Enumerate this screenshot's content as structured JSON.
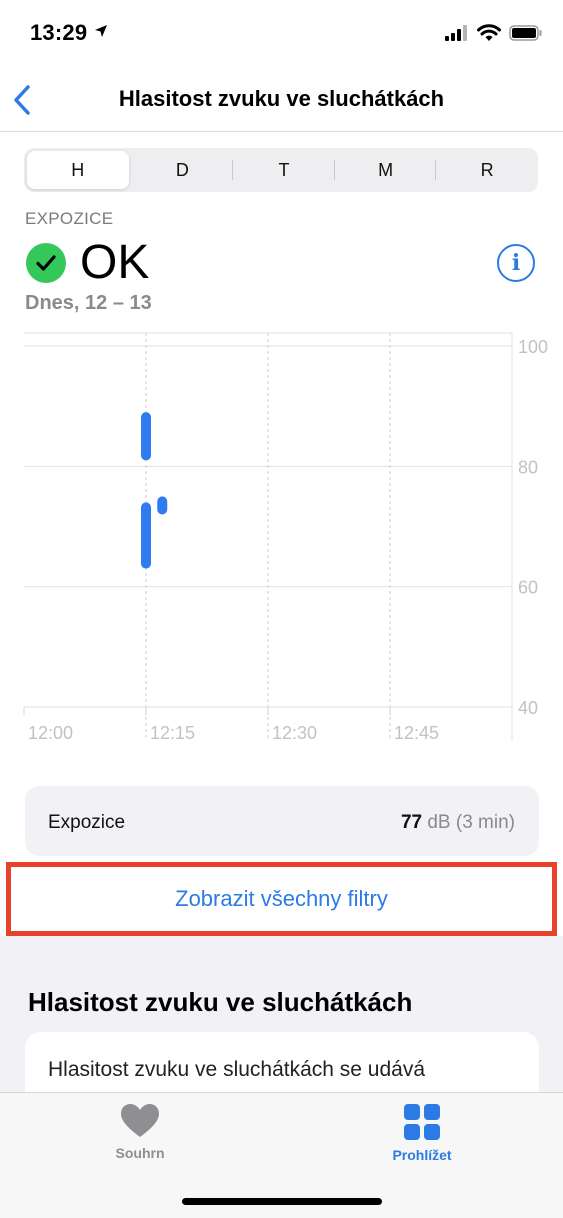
{
  "status_bar": {
    "time": "13:29"
  },
  "nav": {
    "title": "Hlasitost zvuku ve sluchátkách"
  },
  "segments": [
    {
      "label": "H",
      "active": true
    },
    {
      "label": "D",
      "active": false
    },
    {
      "label": "T",
      "active": false
    },
    {
      "label": "M",
      "active": false
    },
    {
      "label": "R",
      "active": false
    }
  ],
  "exposure": {
    "label": "EXPOZICE",
    "status": "OK",
    "date_range": "Dnes, 12 – 13"
  },
  "chart_data": {
    "type": "range-bar",
    "x_ticks": [
      "12:00",
      "12:15",
      "12:30",
      "12:45"
    ],
    "y_ticks": [
      "100",
      "80",
      "60",
      "40"
    ],
    "ylim": [
      40,
      100
    ],
    "ranges": [
      {
        "x": "12:15",
        "low": 81,
        "high": 89
      },
      {
        "x": "12:15",
        "low": 63,
        "high": 74
      },
      {
        "x": "12:17",
        "low": 72,
        "high": 75
      }
    ],
    "bar_color": "#2f7bf0"
  },
  "summary_card": {
    "label": "Expozice",
    "value_number": "77",
    "value_unit": "dB (3 min)"
  },
  "filters_button": {
    "label": "Zobrazit všechny filtry"
  },
  "about": {
    "title": "Hlasitost zvuku ve sluchátkách",
    "text": "Hlasitost zvuku ve sluchátkách se udává"
  },
  "tab_bar": {
    "tabs": [
      {
        "label": "Souhrn",
        "active": false
      },
      {
        "label": "Prohlížet",
        "active": true
      }
    ]
  },
  "colors": {
    "accent": "#2c7be5",
    "ok_green": "#34c759",
    "highlight_red": "#e8412c"
  }
}
